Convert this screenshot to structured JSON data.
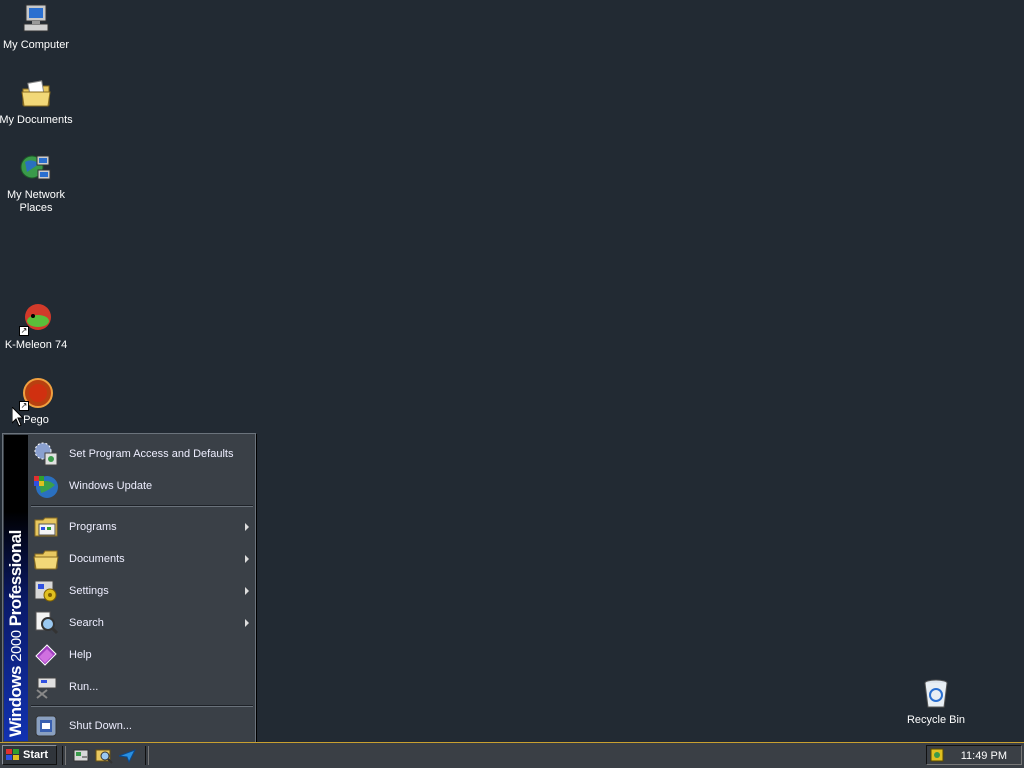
{
  "desktop": {
    "icons": [
      {
        "label": "My Computer",
        "icon": "my-computer-icon"
      },
      {
        "label": "My Documents",
        "icon": "my-documents-icon"
      },
      {
        "label": "My Network Places",
        "icon": "network-places-icon"
      },
      {
        "label": "K-Meleon 74",
        "icon": "k-meleon-icon"
      },
      {
        "label": "Pego",
        "icon": "pego-icon"
      },
      {
        "label": "Recycle Bin",
        "icon": "recycle-bin-icon"
      }
    ]
  },
  "start_menu": {
    "banner": {
      "brand": "Windows",
      "version": "2000",
      "edition": "Professional"
    },
    "items": [
      {
        "label": "Set Program Access and Defaults",
        "icon": "program-access-icon",
        "submenu": false
      },
      {
        "label": "Windows Update",
        "icon": "windows-update-icon",
        "submenu": false
      },
      {
        "label": "Programs",
        "icon": "programs-icon",
        "submenu": true
      },
      {
        "label": "Documents",
        "icon": "documents-folder-icon",
        "submenu": true
      },
      {
        "label": "Settings",
        "icon": "settings-icon",
        "submenu": true
      },
      {
        "label": "Search",
        "icon": "search-icon",
        "submenu": true
      },
      {
        "label": "Help",
        "icon": "help-book-icon",
        "submenu": false
      },
      {
        "label": "Run...",
        "icon": "run-icon",
        "submenu": false
      },
      {
        "label": "Shut Down...",
        "icon": "shut-down-icon",
        "submenu": false
      }
    ]
  },
  "taskbar": {
    "start_label": "Start",
    "quick_launch": [
      "show-desktop-icon",
      "internet-explorer-icon",
      "outlook-express-icon"
    ],
    "tray_icon": "tray-app-icon",
    "clock": "11:49 PM"
  },
  "colors": {
    "desktop_bg": "#222a33",
    "menu_bg": "#3a4047",
    "taskbar_border": "#c8a030",
    "banner_blue": "#1232b0"
  }
}
